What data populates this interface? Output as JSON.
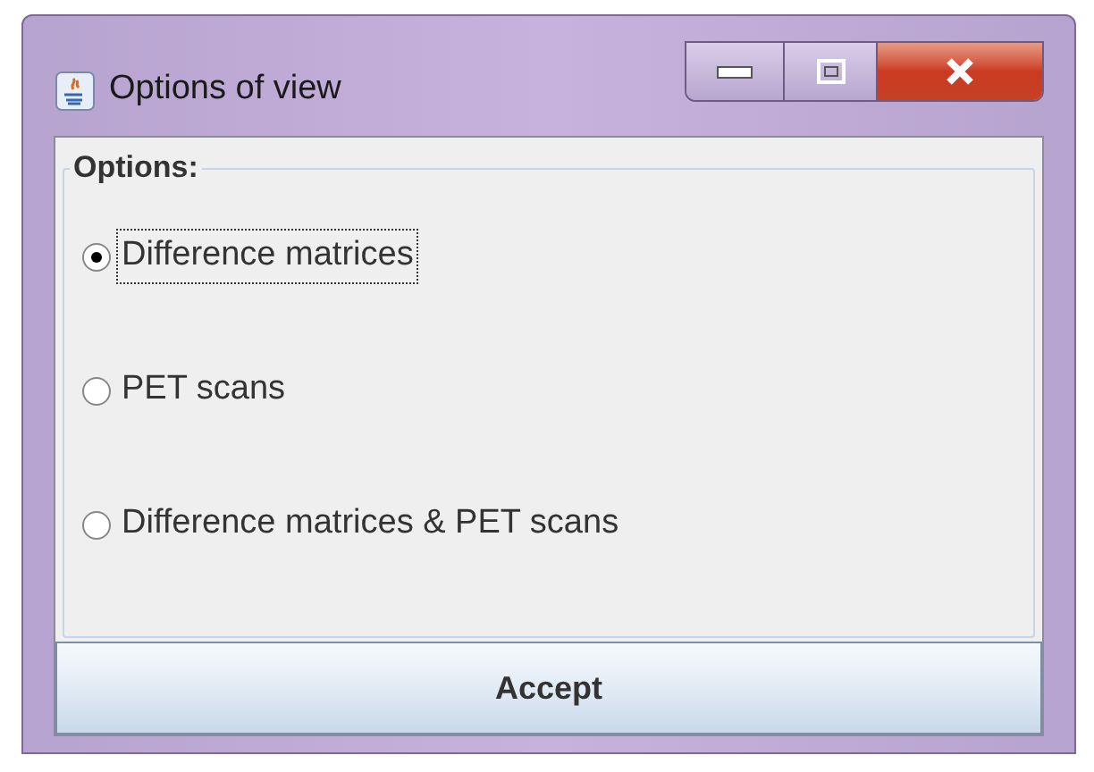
{
  "window": {
    "title": "Options of view"
  },
  "group": {
    "title": "Options:"
  },
  "options": [
    {
      "label": "Difference matrices",
      "selected": true
    },
    {
      "label": "PET scans",
      "selected": false
    },
    {
      "label": "Difference matrices & PET scans",
      "selected": false
    }
  ],
  "button": {
    "label": "Accept"
  }
}
